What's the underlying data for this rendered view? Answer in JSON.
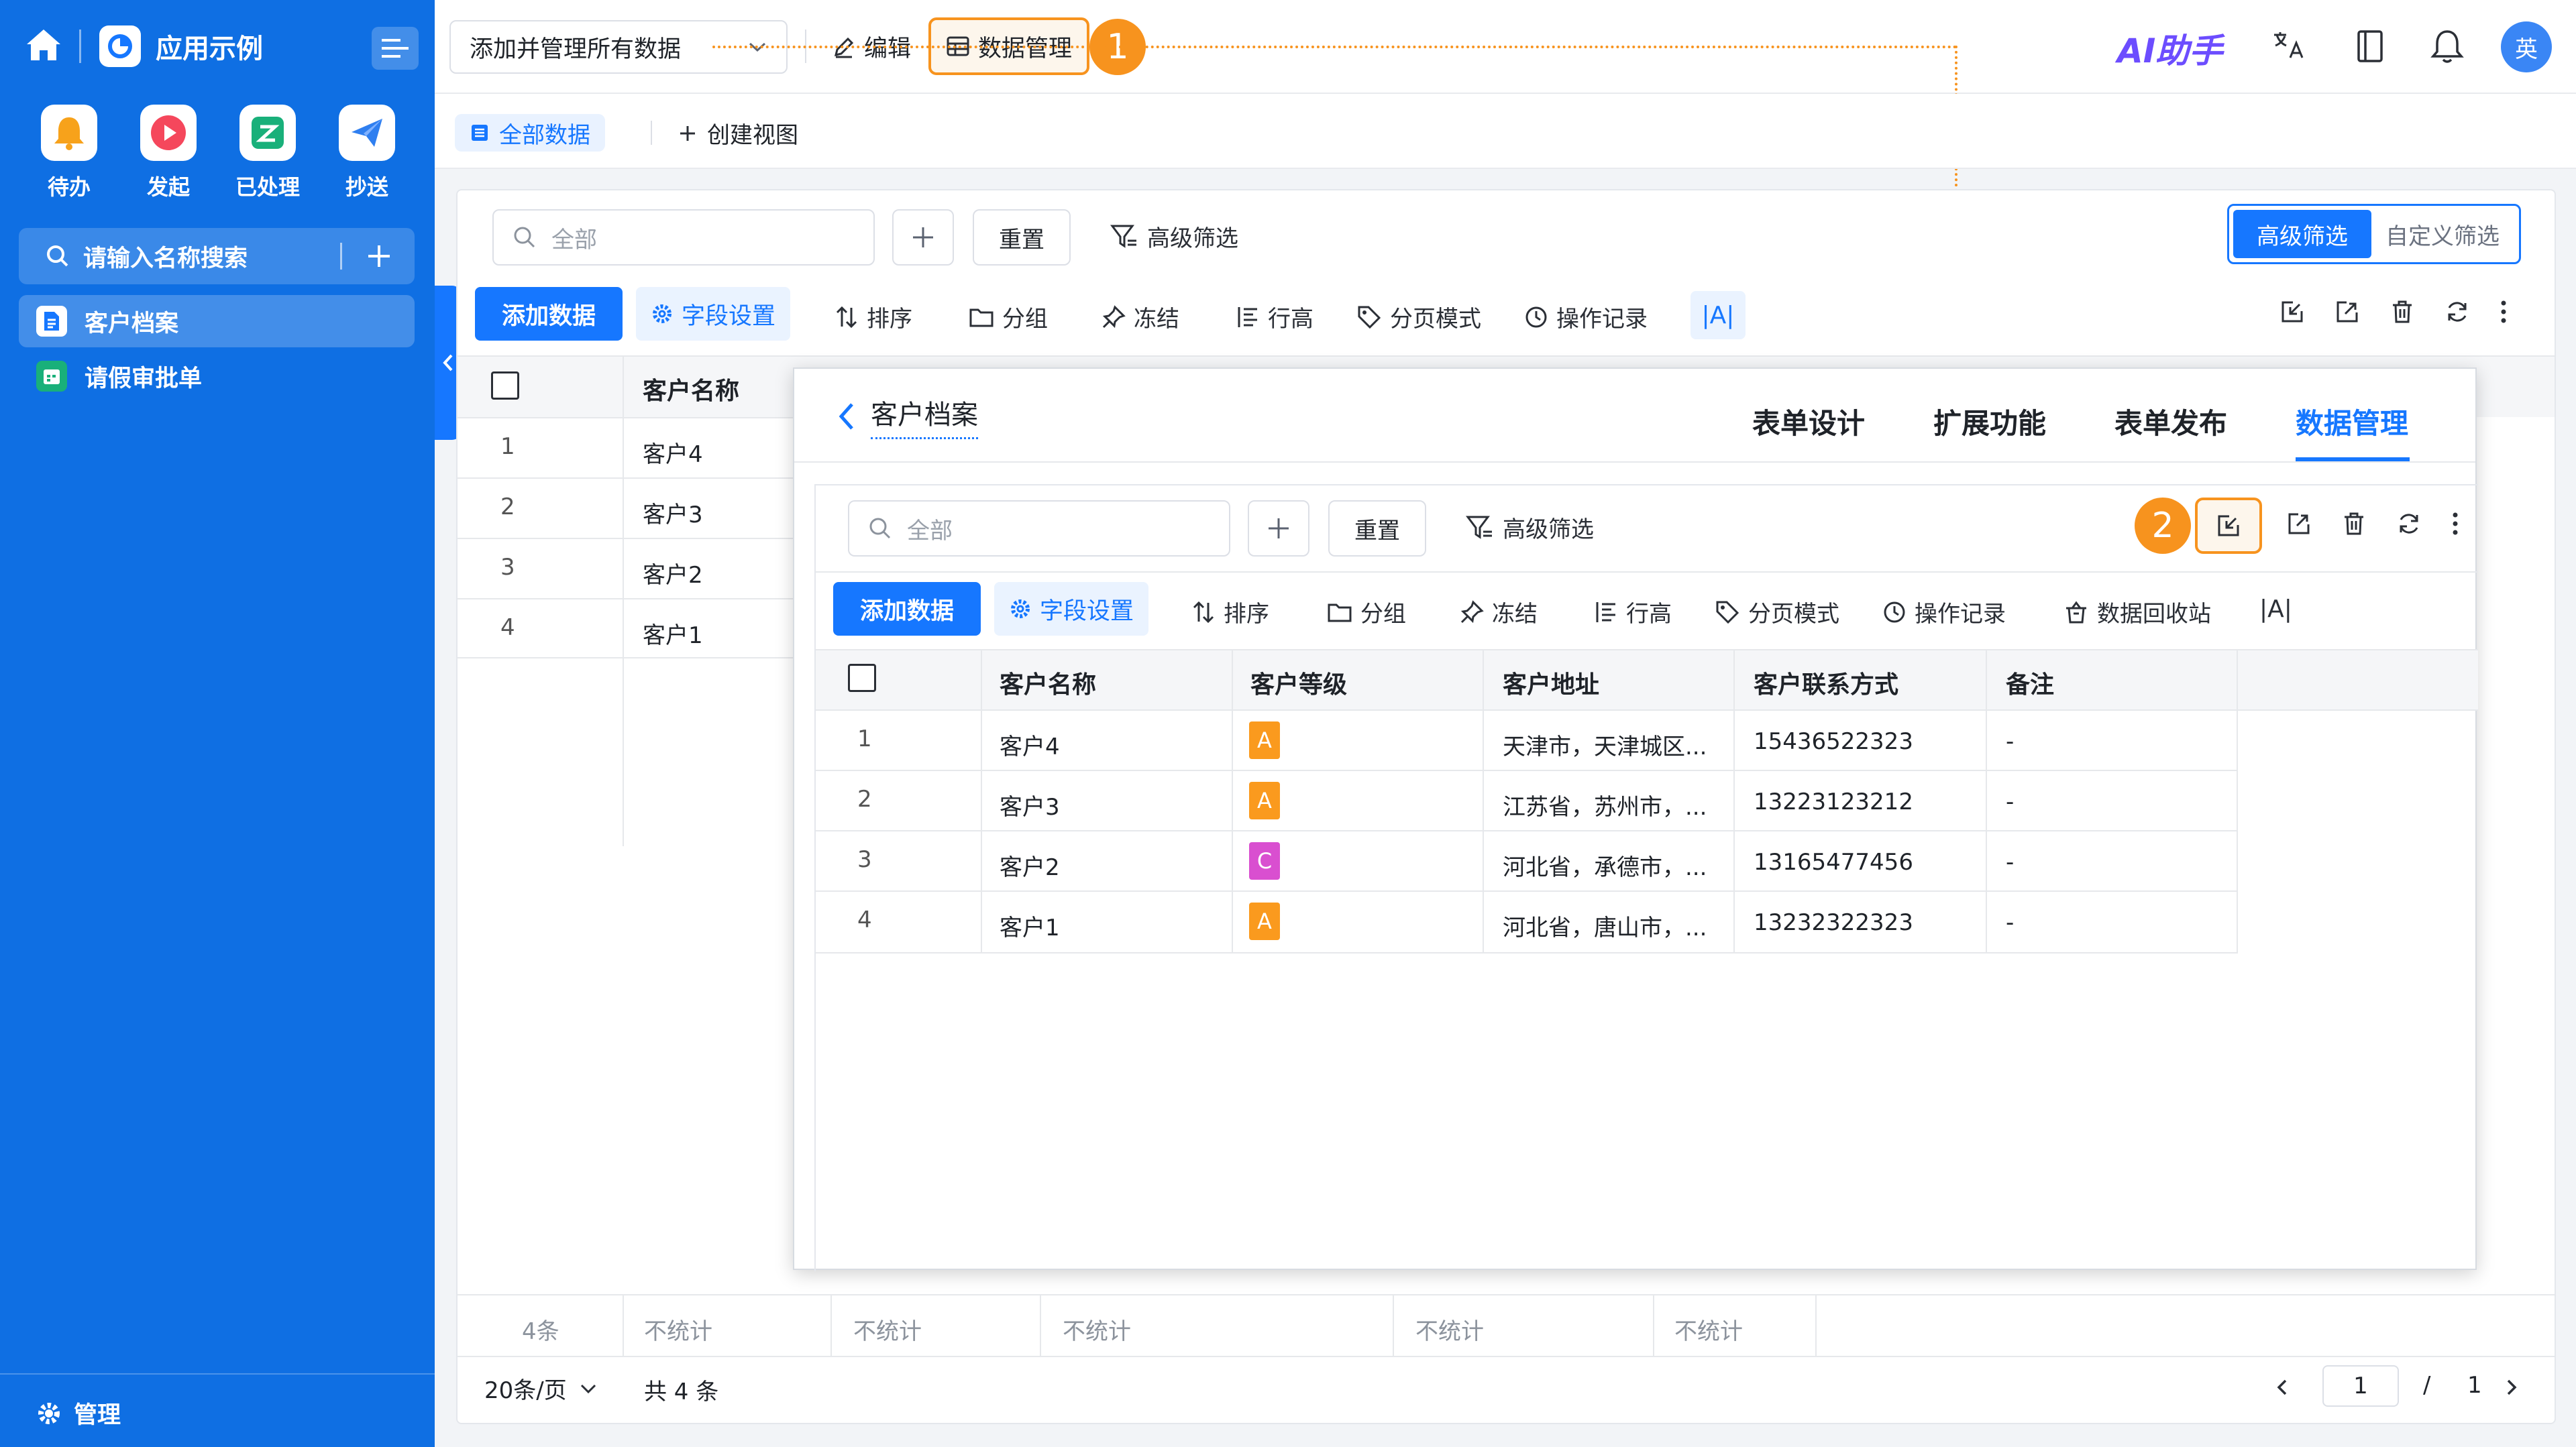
{
  "sidebar": {
    "app_title": "应用示例",
    "quick_apps": [
      {
        "label": "待办",
        "icon": "bell-icon",
        "color": "#f7a21b"
      },
      {
        "label": "发起",
        "icon": "play-icon",
        "color": "#f5475c"
      },
      {
        "label": "已处理",
        "icon": "check-box-icon",
        "color": "#19b07a"
      },
      {
        "label": "抄送",
        "icon": "send-icon",
        "color": "#2f7ff0"
      }
    ],
    "search_placeholder": "请输入名称搜索",
    "items": [
      {
        "label": "客户档案",
        "icon": "document-icon",
        "active": true
      },
      {
        "label": "请假审批单",
        "icon": "calendar-icon",
        "active": false
      }
    ],
    "footer_label": "管理"
  },
  "topbar": {
    "select_value": "添加并管理所有数据",
    "edit_label": "编辑",
    "data_mgmt_label": "数据管理",
    "callout_1": "1",
    "ai_label": "AI助手",
    "avatar_text": "英"
  },
  "view_tabs": {
    "all_data": "全部数据",
    "create_view": "创建视图"
  },
  "filter_bar": {
    "search_placeholder": "全部",
    "reset": "重置",
    "advanced": "高级筛选",
    "toggle": [
      "高级筛选",
      "自定义筛选"
    ]
  },
  "toolbar": {
    "add_data": "添加数据",
    "field_settings": "字段设置",
    "sort": "排序",
    "group": "分组",
    "freeze": "冻结",
    "row_height": "行高",
    "paging": "分页模式",
    "op_log": "操作记录",
    "recycle": "数据回收站",
    "text_fit": "|A|"
  },
  "bg_table": {
    "header_name": "客户名称",
    "rows": [
      {
        "no": "1",
        "name": "客户4"
      },
      {
        "no": "2",
        "name": "客户3"
      },
      {
        "no": "3",
        "name": "客户2"
      },
      {
        "no": "4",
        "name": "客户1"
      }
    ],
    "summary": [
      "4条",
      "不统计",
      "不统计",
      "不统计",
      "不统计",
      "不统计"
    ]
  },
  "pagination": {
    "page_size": "20条/页",
    "total": "共 4 条",
    "current": "1",
    "sep": "/",
    "pages": "1"
  },
  "overlay": {
    "back_title": "客户档案",
    "tabs": [
      "表单设计",
      "扩展功能",
      "表单发布",
      "数据管理"
    ],
    "active_tab": 3,
    "callout_2": "2",
    "columns": [
      "客户名称",
      "客户等级",
      "客户地址",
      "客户联系方式",
      "备注"
    ],
    "rows": [
      {
        "no": "1",
        "name": "客户4",
        "level": "A",
        "level_color": "#fa9a1e",
        "address": "天津市，天津城区...",
        "phone": "15436522323",
        "note": "-"
      },
      {
        "no": "2",
        "name": "客户3",
        "level": "A",
        "level_color": "#fa9a1e",
        "address": "江苏省，苏州市，...",
        "phone": "13223123212",
        "note": "-"
      },
      {
        "no": "3",
        "name": "客户2",
        "level": "C",
        "level_color": "#d94fd0",
        "address": "河北省，承德市，...",
        "phone": "13165477456",
        "note": "-"
      },
      {
        "no": "4",
        "name": "客户1",
        "level": "A",
        "level_color": "#fa9a1e",
        "address": "河北省，唐山市，...",
        "phone": "13232322323",
        "note": "-"
      }
    ]
  }
}
